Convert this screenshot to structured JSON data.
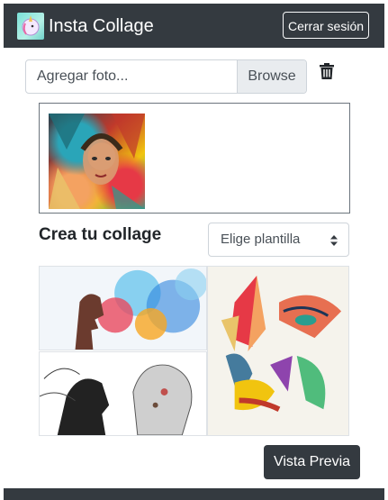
{
  "navbar": {
    "brand_name": "Insta Collage",
    "logout_label": "Cerrar sesión",
    "logo_icon": "unicorn-logo-icon"
  },
  "upload": {
    "placeholder": "Agregar foto...",
    "browse_label": "Browse",
    "delete_icon": "trash-icon"
  },
  "collage": {
    "title": "Crea tu collage",
    "template_select_value": "Elige plantilla",
    "preview_label": "Vista Previa"
  },
  "colors": {
    "navbar_bg": "#343a40",
    "button_dark": "#343a40",
    "input_border": "#ced4da",
    "browse_bg": "#e9ecef"
  }
}
